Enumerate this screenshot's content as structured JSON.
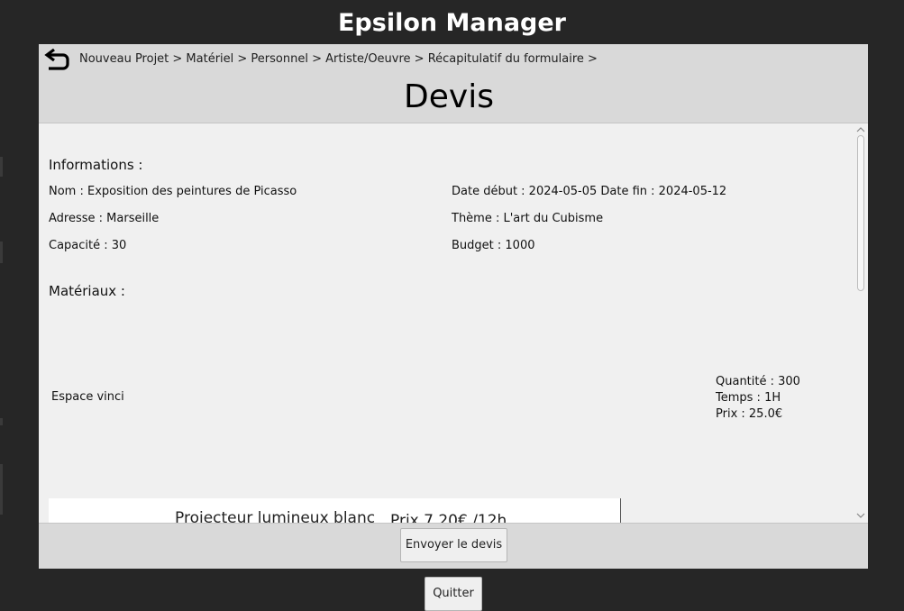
{
  "app": {
    "title": "Epsilon Manager"
  },
  "header": {
    "back_icon": "undo-arrow-icon",
    "breadcrumb": "Nouveau Projet > Matériel > Personnel > Artiste/Oeuvre > Récapitulatif du formulaire >",
    "page_title": "Devis"
  },
  "informations": {
    "title": "Informations :",
    "nom": "Nom : Exposition des peintures de Picasso",
    "dates": "Date début : 2024-05-05 Date fin : 2024-05-12",
    "adresse": "Adresse : Marseille",
    "theme": "Thème : L'art du Cubisme",
    "capacite": "Capacité : 30",
    "budget": "Budget : 1000"
  },
  "materiaux": {
    "title": "Matériaux :",
    "items": [
      {
        "name": "Espace vinci",
        "quantite": "Quantité : 300",
        "temps": "Temps : 1H",
        "prix": "Prix : 25.0€"
      }
    ],
    "partial_card": {
      "name": "Projecteur lumineux blanc",
      "price": "Prix 7.20€ /12h"
    }
  },
  "actions": {
    "send_label": "Envoyer le devis",
    "quit_label": "Quitter"
  },
  "colors": {
    "background": "#262626",
    "panel": "#d9d9d9",
    "content": "#f0f0f0"
  }
}
